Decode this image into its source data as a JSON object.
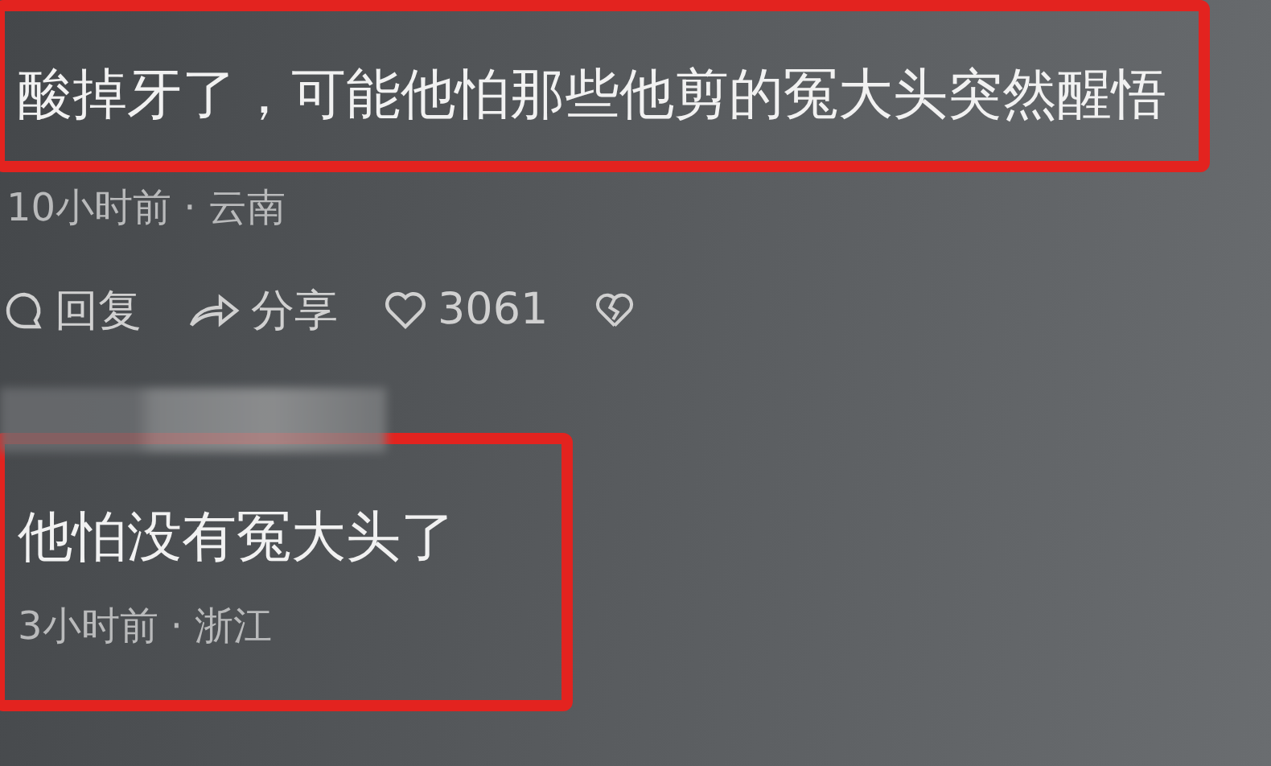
{
  "comments": [
    {
      "highlighted": true,
      "text": "酸掉牙了，可能他怕那些他剪的冤大头突然醒悟",
      "meta": "10小时前 · 云南",
      "actions": [
        {
          "kind": "reply",
          "label": "回复"
        },
        {
          "kind": "share",
          "label": "分享"
        },
        {
          "kind": "like",
          "label": "3061"
        },
        {
          "kind": "dislike"
        }
      ]
    },
    {
      "author_blurred": true,
      "highlighted": true,
      "text": "他怕没有冤大头了",
      "meta": "3小时前 · 浙江"
    }
  ]
}
